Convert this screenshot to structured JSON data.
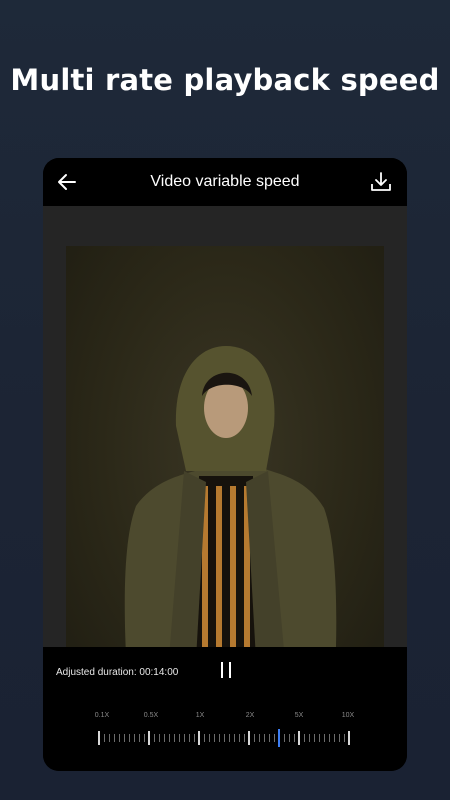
{
  "headline": "Multi rate playback speed",
  "screen": {
    "title": "Video variable speed",
    "back_icon": "arrow-left-icon",
    "download_icon": "download-icon"
  },
  "player": {
    "duration_label": "Adjusted duration: 00:14:00",
    "pause_icon": "pause-icon"
  },
  "speed_slider": {
    "labels": [
      "0.1X",
      "0.5X",
      "1X",
      "2X",
      "5X",
      "10X"
    ],
    "selected_fraction": 0.72
  },
  "colors": {
    "accent": "#3d7ef4",
    "background": "#1c2434"
  }
}
